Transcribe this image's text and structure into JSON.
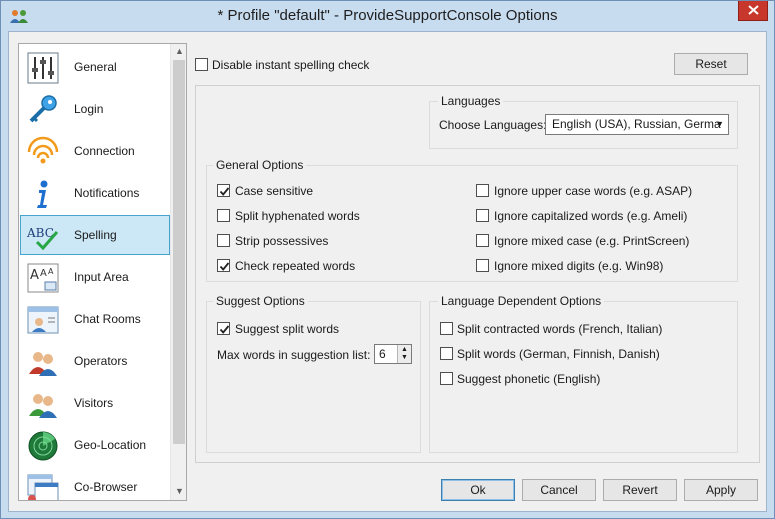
{
  "window": {
    "title": "* Profile \"default\" - ProvideSupportConsole Options",
    "icon": "app-users-icon",
    "close_icon": "close-icon"
  },
  "sidebar": {
    "items": [
      {
        "label": "General",
        "icon": "sliders-icon",
        "selected": false
      },
      {
        "label": "Login",
        "icon": "key-icon",
        "selected": false
      },
      {
        "label": "Connection",
        "icon": "wifi-signal-icon",
        "selected": false
      },
      {
        "label": "Notifications",
        "icon": "info-icon",
        "selected": false
      },
      {
        "label": "Spelling",
        "icon": "abc-check-icon",
        "selected": true
      },
      {
        "label": "Input Area",
        "icon": "font-size-icon",
        "selected": false
      },
      {
        "label": "Chat Rooms",
        "icon": "chat-window-icon",
        "selected": false
      },
      {
        "label": "Operators",
        "icon": "operators-icon",
        "selected": false
      },
      {
        "label": "Visitors",
        "icon": "visitors-icon",
        "selected": false
      },
      {
        "label": "Geo-Location",
        "icon": "radar-icon",
        "selected": false
      },
      {
        "label": "Co-Browser",
        "icon": "co-browser-icon",
        "selected": false
      }
    ]
  },
  "top": {
    "disable_spell_check": {
      "label": "Disable instant spelling check",
      "checked": false
    },
    "reset_label": "Reset"
  },
  "languages": {
    "title": "Languages",
    "choose_label": "Choose Languages:",
    "selected_value": "English (USA), Russian, Germa"
  },
  "general_options": {
    "title": "General Options",
    "left": [
      {
        "label": "Case sensitive",
        "checked": true
      },
      {
        "label": "Split hyphenated words",
        "checked": false
      },
      {
        "label": "Strip possessives",
        "checked": false
      },
      {
        "label": "Check repeated words",
        "checked": true
      }
    ],
    "right": [
      {
        "label": "Ignore upper case words (e.g. ASAP)",
        "checked": false
      },
      {
        "label": "Ignore capitalized words (e.g. Ameli)",
        "checked": false
      },
      {
        "label": "Ignore mixed case (e.g. PrintScreen)",
        "checked": false
      },
      {
        "label": "Ignore mixed digits (e.g. Win98)",
        "checked": false
      }
    ]
  },
  "suggest_options": {
    "title": "Suggest Options",
    "split_words": {
      "label": "Suggest split words",
      "checked": true
    },
    "max_words_label": "Max words in suggestion list:",
    "max_words_value": "6"
  },
  "language_dependent": {
    "title": "Language Dependent Options",
    "items": [
      {
        "label": "Split contracted words (French, Italian)",
        "checked": false
      },
      {
        "label": "Split words (German, Finnish, Danish)",
        "checked": false
      },
      {
        "label": "Suggest phonetic (English)",
        "checked": false
      }
    ]
  },
  "footer": {
    "ok": "Ok",
    "cancel": "Cancel",
    "revert": "Revert",
    "apply": "Apply"
  }
}
